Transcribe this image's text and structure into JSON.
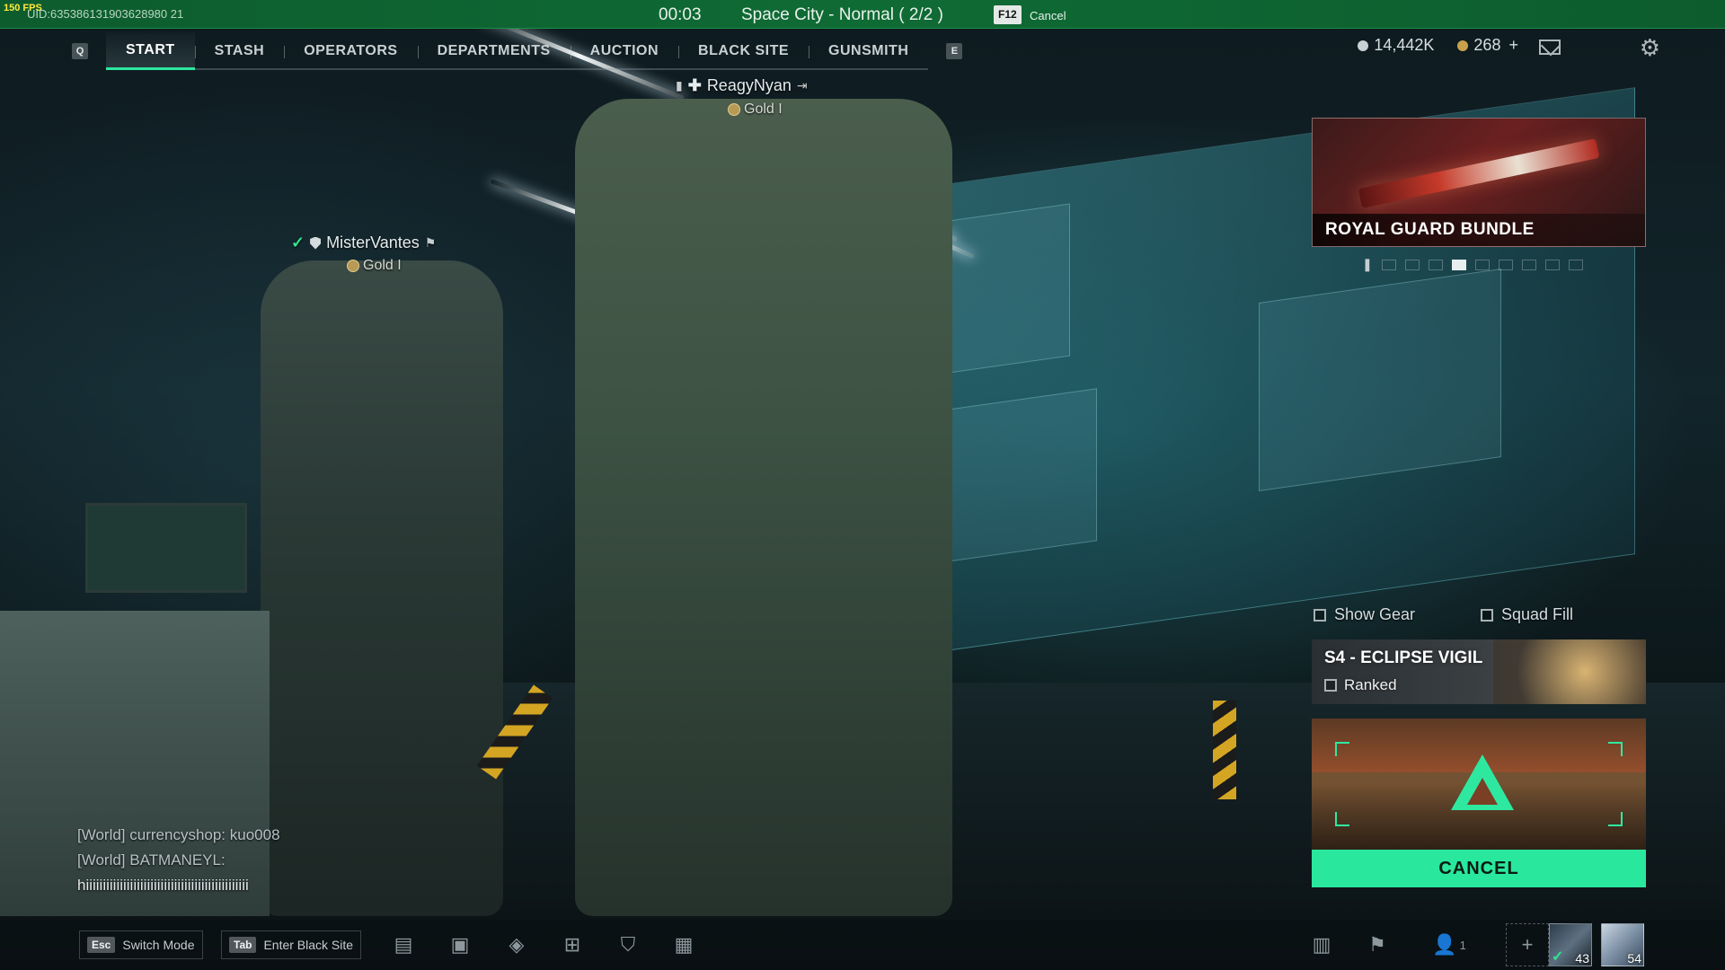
{
  "status_bar": {
    "fps": "150 FPS",
    "uid": "UID:635386131903628980 21",
    "timer": "00:03",
    "map": "Space City - Normal ( 2/2 )",
    "cancel_key": "F12",
    "cancel_label": "Cancel"
  },
  "nav": {
    "left_key": "Q",
    "right_key": "E",
    "items": [
      {
        "label": "START",
        "active": true
      },
      {
        "label": "STASH"
      },
      {
        "label": "OPERATORS"
      },
      {
        "label": "DEPARTMENTS"
      },
      {
        "label": "AUCTION"
      },
      {
        "label": "BLACK SITE"
      },
      {
        "label": "GUNSMITH"
      }
    ]
  },
  "currency": {
    "silver": "14,442K",
    "gold": "268",
    "gold_add": "+"
  },
  "players": {
    "leader": {
      "name": "ReagyNyan",
      "rank": "Gold I"
    },
    "teammate": {
      "name": "MisterVantes",
      "rank": "Gold I"
    }
  },
  "bundle": {
    "title": "ROYAL GUARD BUNDLE",
    "dots": 10,
    "active_dot": 4
  },
  "toggles": {
    "show_gear": "Show Gear",
    "squad_fill": "Squad Fill"
  },
  "season": {
    "title": "S4 - ECLIPSE VIGIL",
    "mode": "Ranked"
  },
  "cancel_button": "CANCEL",
  "chat": {
    "lines": [
      "[World] currencyshop: kuo008",
      "[World] BATMANEYL:"
    ],
    "input": "hiiiiiiiiiiiiiiiiiiiiiiiiiiiiiiiiiiiiiiiiiiiiiiii"
  },
  "bottom": {
    "switch_key": "Esc",
    "switch_label": "Switch Mode",
    "blacksite_key": "Tab",
    "blacksite_label": "Enter Black Site",
    "party_count": "1",
    "avatar1_level": "43",
    "avatar2_level": "54",
    "icons": [
      "chat-icon",
      "briefcase-icon",
      "mask-icon",
      "cart-icon",
      "shield-lightning-icon",
      "calendar-icon",
      "stats-icon",
      "flag-icon",
      "party-icon",
      "plus-icon"
    ]
  },
  "colors": {
    "accent": "#29e89d",
    "status_bar": "#0f6b34"
  }
}
